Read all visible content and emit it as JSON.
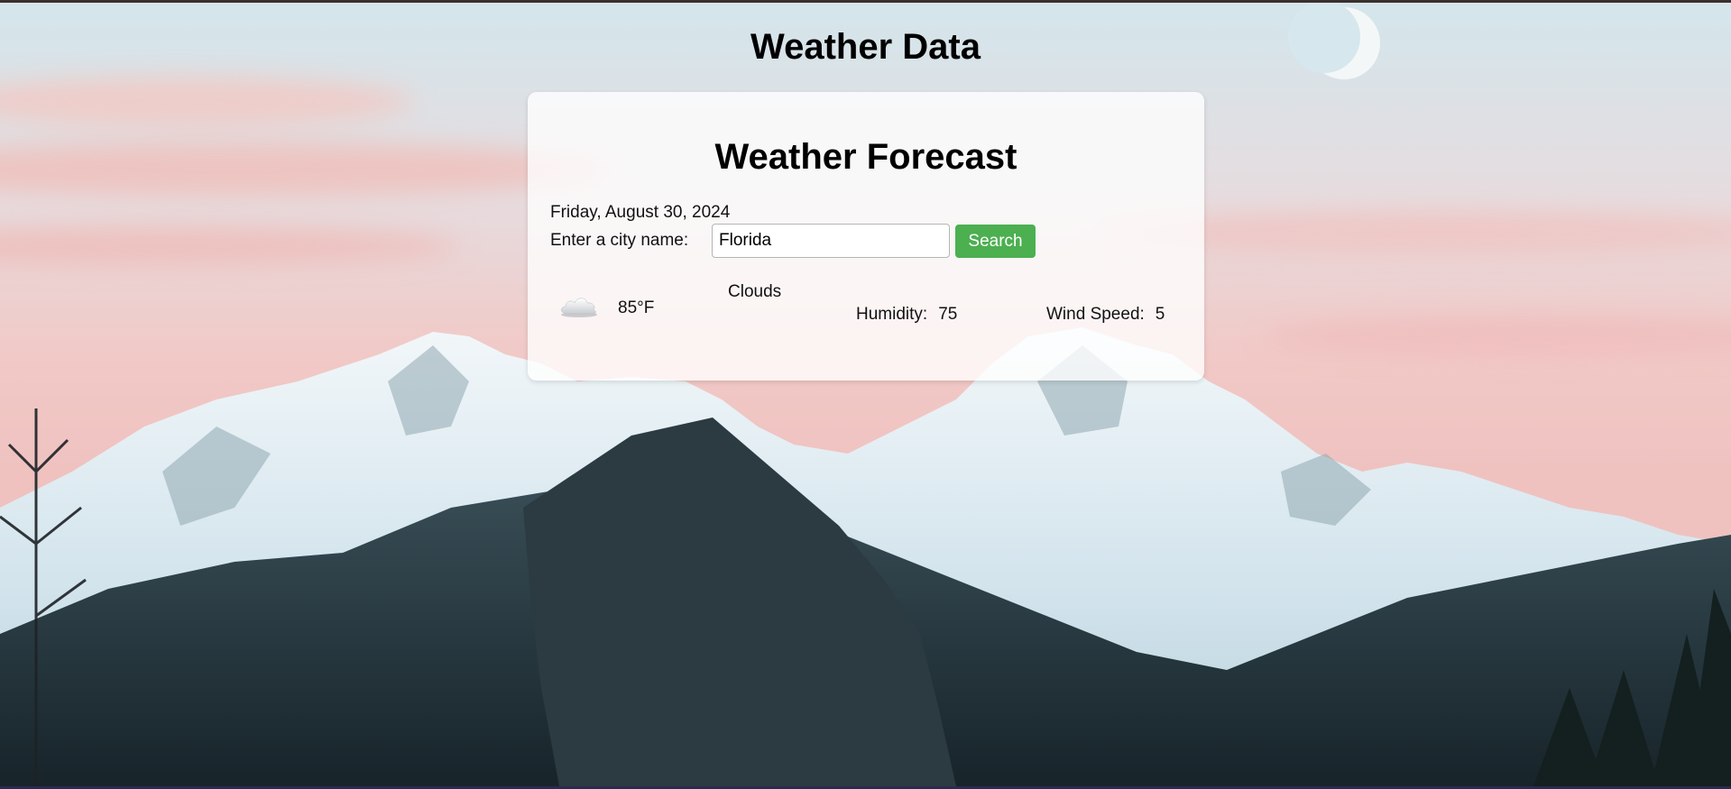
{
  "page": {
    "title": "Weather Data"
  },
  "card": {
    "title": "Weather Forecast",
    "date": "Friday, August 30, 2024",
    "city_label": "Enter a city name:",
    "city_value": "Florida",
    "search_label": "Search"
  },
  "weather": {
    "icon": "cloud-icon",
    "temperature": "85°F",
    "description": "Clouds",
    "humidity_label": "Humidity:",
    "humidity_value": "75",
    "wind_label": "Wind Speed:",
    "wind_value": "5"
  },
  "colors": {
    "accent": "#4caf50",
    "sky_top": "#d3e6ec",
    "sky_pink": "#f1c9c6",
    "snow": "#e9f2f6",
    "forest": "#1f2e33"
  }
}
